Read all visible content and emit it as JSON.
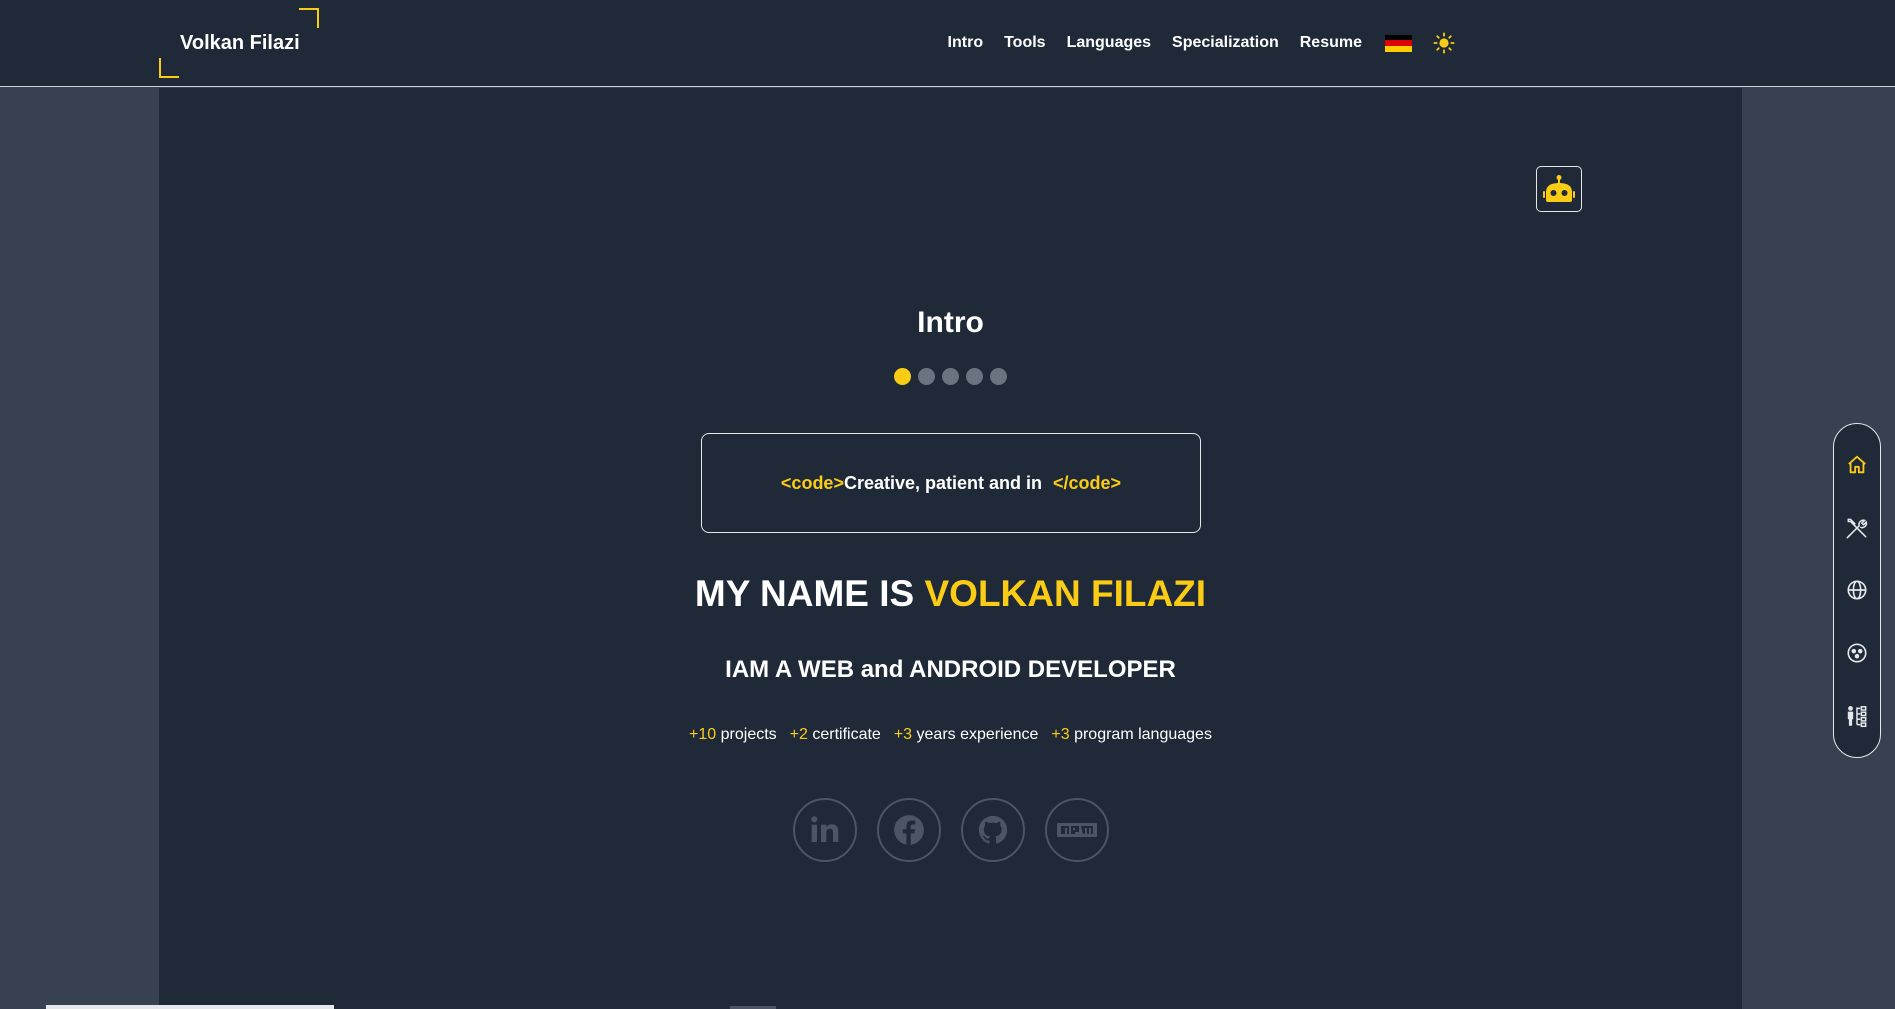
{
  "header": {
    "logo_text": "Volkan Filazi",
    "nav": [
      "Intro",
      "Tools",
      "Languages",
      "Specialization",
      "Resume"
    ],
    "language_flag": "germany-flag-icon",
    "theme_toggle": "sun-icon"
  },
  "main": {
    "assistant_button": "robot-icon",
    "section_title": "Intro",
    "slide_count": 5,
    "active_slide": 1,
    "code_open": "<code>",
    "code_text": "Creative, patient and in ",
    "code_close": "</code>",
    "name_prefix": "MY NAME IS ",
    "name": "VOLKAN FILAZI",
    "role": "IAM A WEB and ANDROID DEVELOPER",
    "stats": [
      {
        "num": "+10",
        "label": " projects"
      },
      {
        "num": "+2",
        "label": " certificate"
      },
      {
        "num": "+3",
        "label": " years experience"
      },
      {
        "num": "+3",
        "label": " program languages"
      }
    ],
    "socials": [
      "linkedin-icon",
      "facebook-icon",
      "github-icon",
      "npm-icon"
    ]
  },
  "side_nav": [
    "home-icon",
    "tools-icon",
    "globe-icon",
    "specialization-icon",
    "resume-icon"
  ],
  "colors": {
    "accent": "#facc15",
    "background": "#1f2937",
    "side_background": "#374151"
  }
}
